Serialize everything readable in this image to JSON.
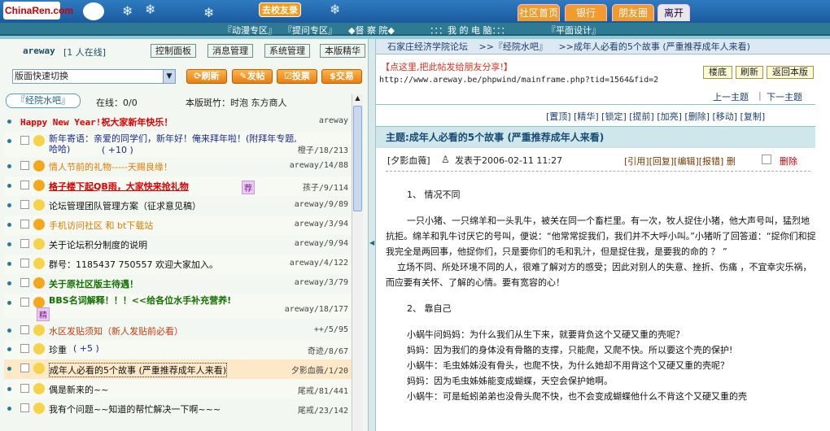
{
  "banner": {
    "logo": "ChinaRen.com",
    "go_home": "去校友录"
  },
  "toptabs": [
    "社区首页",
    "银行",
    "朋友圈",
    "离开"
  ],
  "nav": [
    "『动漫专区』",
    "『提问专区』",
    "◆督 察 院◆",
    "：：：我 的 电 脑：：：",
    "『平面设计』"
  ],
  "left": {
    "user": "areway",
    "online": "[1 人在线]",
    "buttons": [
      "控制面板",
      "消息管理",
      "系统管理",
      "本版精华"
    ],
    "select": "版面快速切换",
    "actions": [
      "刷新",
      "发帖",
      "投票",
      "交易"
    ],
    "forum_tab": "『经院水吧』",
    "online_count": "在线：0/0",
    "moderators": "本版斑竹：时泡 东方商人"
  },
  "threads": [
    {
      "title": "Happy New Year!祝大家新年快乐！",
      "author": "areway",
      "style": "red"
    },
    {
      "title": "新年寄语：亲爱的同学们，新年好！俺来拜年啦！(附拜年专题,哈哈)",
      "extra": "( +10 )",
      "author": "橙子/18/213",
      "style": "blue"
    },
    {
      "title": "情人节前的礼物-----天赐良缘！",
      "author": "areway/14/88",
      "style": "orange"
    },
    {
      "title": "格子楼下起QB雨，大家快来抢礼物",
      "author": "孩子/9/114",
      "style": "redu",
      "badge": "荐"
    },
    {
      "title": "论坛管理团队管理方案（征求意见稿）",
      "author": "areway/9/89",
      "style": "normal"
    },
    {
      "title": "手机访问社区  和  bt下载站",
      "author": "areway/3/94",
      "style": "orange"
    },
    {
      "title": "关于论坛积分制度的说明",
      "author": "areway/9/94",
      "style": "normal"
    },
    {
      "title": "群号：1185437 750557 欢迎大家加入。",
      "author": "areway/4/122",
      "style": "normal"
    },
    {
      "title": "关于原社区版主待遇！",
      "author": "areway/3/79",
      "style": "green"
    },
    {
      "title": "BBS名词解释！！！<<给各位水手补充营养!",
      "author": "areway/18/177",
      "style": "green",
      "badge": "精"
    },
    {
      "title": "水区发贴须知（新人发贴前必看）",
      "author": "++/5/95",
      "style": "redn"
    },
    {
      "title": "珍重",
      "extra": "( +5 )",
      "author": "奇迹/8/67",
      "style": "normal"
    },
    {
      "title": "成年人必看的5个故事 (严重推荐成年人来看)",
      "author": "夕影血薇/1/20",
      "style": "hl"
    },
    {
      "title": "偶是新来的~~",
      "author": "尾戒/81/441",
      "style": "normal"
    },
    {
      "title": "我有个问题~~知道的帮忙解决一下啊~~~",
      "author": "尾戒/23/142",
      "style": "normal"
    }
  ],
  "right": {
    "breadcrumb": [
      "石家庄经济学院论坛",
      ">>『经院水吧』",
      ">>成年人必看的5个故事 (严重推荐成年人来看)"
    ],
    "share": "【点这里,把此帖发给朋友分享!】",
    "url": "http://www.areway.be/phpwind/mainframe.php?tid=1564&fid=2",
    "tools": [
      "楼底",
      "刷新",
      "返回本版"
    ],
    "prev_next": [
      "上一主题",
      "下一主题"
    ],
    "mod_actions": "[置顶] [精华] [锁定] [提前] [加亮] [删除] [移动] [复制]",
    "thread_title": "主题:成年人必看的5个故事 (严重推荐成年人来看)",
    "post_author": "[夕影血薇]",
    "post_date": "发表于2006-02-11 11:27",
    "post_actions": "[引用][回复][编辑][报错] 删",
    "delete": "删除",
    "body": [
      "1、   情况不同",
      "一只小猪、一只绵羊和一头乳牛，被关在同一个畜栏里。有一次，牧人捉住小猪，他大声号叫，猛烈地抗拒。绵羊和乳牛讨厌它的号叫，便说：“他常常捉我们，我们并不大呼小叫。”小猪听了回答道：“捉你们和捉我完全是两回事，他捉你们，只是要你们的毛和乳汁，但是捉住我，是要我的命的 ？ ”",
      "立场不同、所处环境不同的人，很难了解对方的感受；因此对别人的失意、挫折、伤痛 ，不宜幸灾乐祸，而应要有关怀、了解的心情。要有宽容的心！",
      "2、   靠自己",
      "小蜗牛问妈妈：为什么我们从生下来，就要背负这个又硬又重的壳呢？",
      "妈妈：因为我们的身体没有骨骼的支撑，只能爬，又爬不快。所以要这个壳的保护!",
      "小蜗牛：毛虫姊姊没有骨头，也爬不快，为什么她却不用背这个又硬又重的壳呢？",
      "妈妈：因为毛虫姊姊能变成蝴蝶，天空会保护她啊。",
      "小蜗牛：可是蚯蚓弟弟也没骨头爬不快，也不会变成蝴蝶他什么不背这个又硬又重的壳"
    ]
  }
}
